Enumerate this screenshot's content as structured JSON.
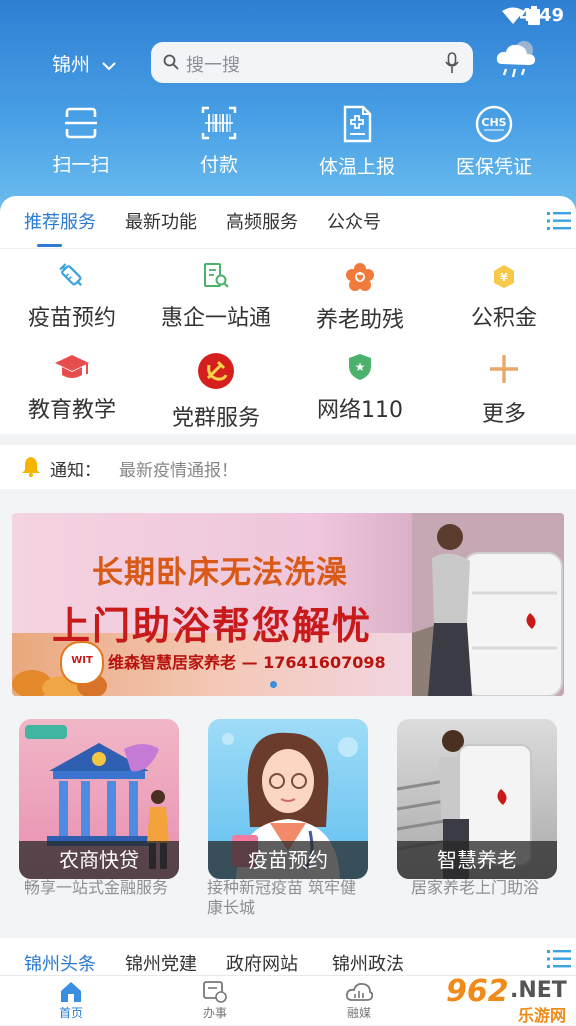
{
  "status_bar": {
    "time": "4:49"
  },
  "header": {
    "city": "锦州",
    "search_placeholder": "搜一搜"
  },
  "quick_actions": [
    {
      "label": "扫一扫",
      "icon": "scan-icon"
    },
    {
      "label": "付款",
      "icon": "barcode-pay-icon"
    },
    {
      "label": "体温上报",
      "icon": "medical-document-icon"
    },
    {
      "label": "医保凭证",
      "icon": "chs-insurance-icon"
    }
  ],
  "service_tabs": [
    "推荐服务",
    "最新功能",
    "高频服务",
    "公众号"
  ],
  "services": [
    {
      "label": "疫苗预约",
      "icon": "vaccine-icon",
      "color": "#3aa3e0"
    },
    {
      "label": "惠企一站通",
      "icon": "enterprise-search-icon",
      "color": "#4cb26b"
    },
    {
      "label": "养老助残",
      "icon": "elderly-care-icon",
      "color": "#f07a3a"
    },
    {
      "label": "公积金",
      "icon": "fund-icon",
      "color": "#f0b93a"
    },
    {
      "label": "教育教学",
      "icon": "graduation-cap-icon",
      "color": "#e84d4d"
    },
    {
      "label": "党群服务",
      "icon": "party-emblem-icon",
      "color": "#d51f1f"
    },
    {
      "label": "网络110",
      "icon": "police-shield-icon",
      "color": "#4cb26b"
    },
    {
      "label": "更多",
      "icon": "plus-icon",
      "color": "#e9a96a"
    }
  ],
  "notice": {
    "label": "通知：",
    "text": "最新疫情通报！"
  },
  "banner": {
    "line1": "长期卧床无法洗澡",
    "line2": "上门助浴帮您解忧",
    "company": "维森智慧居家养老 — 17641607098",
    "logo_text": "WIT"
  },
  "app_cards": [
    {
      "title": "农商快贷",
      "desc": "畅享一站式金融服务"
    },
    {
      "title": "疫苗预约",
      "desc": "接种新冠疫苗 筑牢健康长城"
    },
    {
      "title": "智慧养老",
      "desc": "居家养老上门助浴"
    }
  ],
  "news_tabs": [
    "锦州头条",
    "锦州党建",
    "政府网站",
    "锦州政法"
  ],
  "bottom_nav": [
    {
      "label": "首页",
      "icon": "home-icon"
    },
    {
      "label": "办事",
      "icon": "affairs-icon"
    },
    {
      "label": "融媒",
      "icon": "cloud-media-icon"
    }
  ],
  "watermark": {
    "text1": "962",
    "text2": ".NET",
    "text3": "乐游网"
  },
  "colors": {
    "accent": "#2b7bd0",
    "header_top": "#2e7fd3",
    "header_bottom": "#71c1ef"
  }
}
